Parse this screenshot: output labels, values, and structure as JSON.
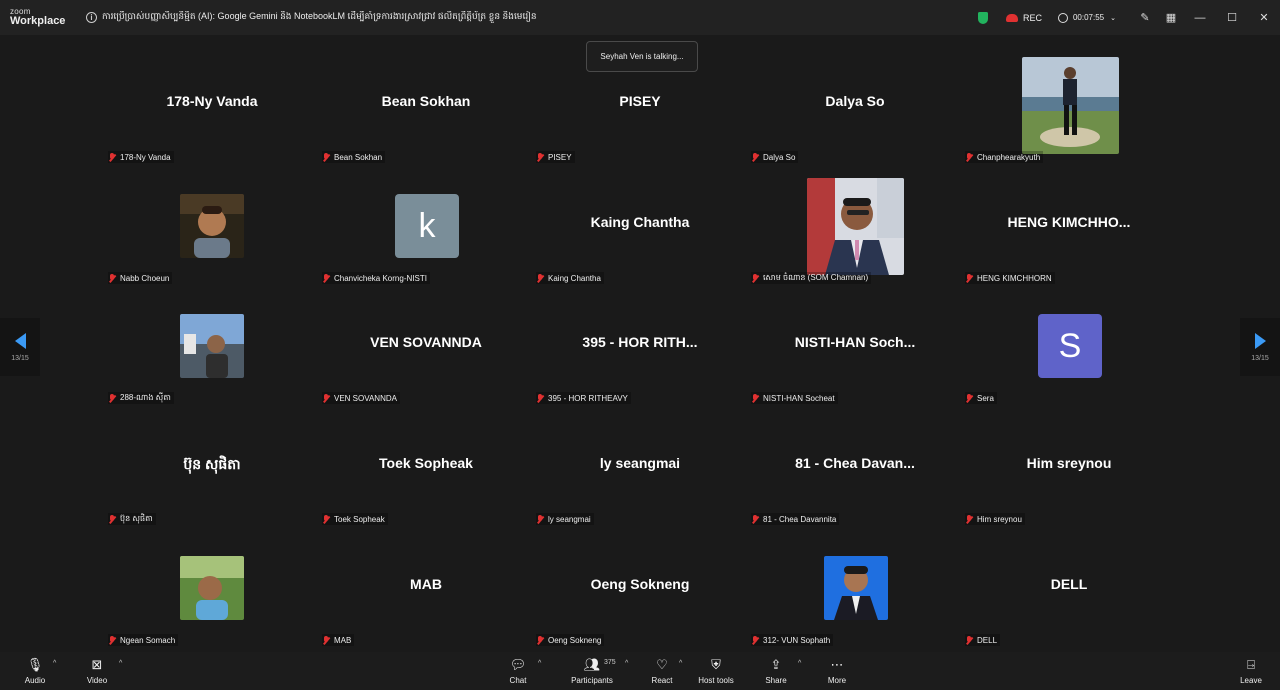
{
  "app": {
    "logo_top": "zoom",
    "logo_bottom": "Workplace",
    "meeting_title": "ការប្រើប្រាស់បញ្ញាសិប្បនិម្មិត (AI): Google Gemini និង NotebookLM ដើម្បីគាំទ្រការងារស្រាវជ្រាវ ផលិតព្រឹត្តិប័ត្រ ខ្លួន និងមេរៀន",
    "rec_label": "REC",
    "timer": "00:07:55",
    "talking": "Seyhah Ven is talking...",
    "page_indicator": "13/15",
    "colors": {
      "accent": "#3b9af5",
      "muted": "#e03131",
      "secure": "#22b35e"
    }
  },
  "tiles": [
    {
      "big": "178-Ny Vanda",
      "label": "178-Ny Vanda"
    },
    {
      "big": "Bean Sokhan",
      "label": "Bean Sokhan"
    },
    {
      "big": "PISEY",
      "label": "PISEY"
    },
    {
      "big": "Dalya So",
      "label": "Dalya So"
    },
    {
      "big": "",
      "label": "Chanphearakyuth"
    },
    {
      "big": "",
      "label": "Nabb Choeun"
    },
    {
      "big": "",
      "label": "Chanvicheka Korng-NISTI",
      "avatar": "k"
    },
    {
      "big": "Kaing Chantha",
      "label": "Kaing Chantha"
    },
    {
      "big": "",
      "label": "សោម ចំណាន (SOM Chamnan)"
    },
    {
      "big": "HENG  KIMCHHO...",
      "label": "HENG KIMCHHORN"
    },
    {
      "big": "",
      "label": "288-ណាង ស៊ីតា"
    },
    {
      "big": "VEN SOVANNDA",
      "label": "VEN SOVANNDA"
    },
    {
      "big": "395  - HOR RITH...",
      "label": "395 - HOR RITHEAVY"
    },
    {
      "big": "NISTI-HAN  Soch...",
      "label": "NISTI-HAN Socheat"
    },
    {
      "big": "",
      "label": "Sera",
      "avatar": "S"
    },
    {
      "big": "ប៊ុន សុផិតា",
      "label": "ប៊ុន សុផិតា"
    },
    {
      "big": "Toek Sopheak",
      "label": "Toek Sopheak"
    },
    {
      "big": "ly seangmai",
      "label": "ly seangmai"
    },
    {
      "big": "81  - Chea Davan...",
      "label": "81 - Chea Davannita"
    },
    {
      "big": "Him sreynou",
      "label": "Him sreynou"
    },
    {
      "big": "",
      "label": "Ngean Somach"
    },
    {
      "big": "MAB",
      "label": "MAB"
    },
    {
      "big": "Oeng Sokneng",
      "label": "Oeng Sokneng"
    },
    {
      "big": "",
      "label": "312- VUN Sophath"
    },
    {
      "big": "DELL",
      "label": "DELL"
    }
  ],
  "toolbar": {
    "audio": "Audio",
    "video": "Video",
    "chat": "Chat",
    "participants": "Participants",
    "participants_count": "375",
    "react": "React",
    "host_tools": "Host tools",
    "share": "Share",
    "more": "More",
    "leave": "Leave"
  }
}
